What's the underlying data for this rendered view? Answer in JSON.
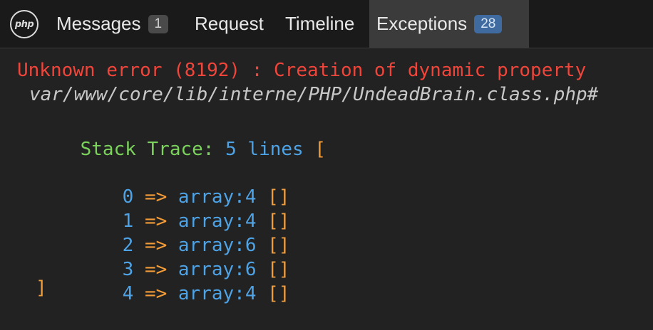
{
  "toolbar": {
    "logo_text": "php",
    "tabs": [
      {
        "label": "Messages",
        "badge": "1"
      },
      {
        "label": "Request"
      },
      {
        "label": "Timeline"
      },
      {
        "label": "Exceptions",
        "badge": "28",
        "active": true
      }
    ]
  },
  "exception": {
    "message": "Unknown error (8192) : Creation of dynamic property",
    "path": "var/www/core/lib/interne/PHP/UndeadBrain.class.php#",
    "trace_label": "Stack Trace:",
    "trace_count": "5 lines",
    "open_bracket": "[",
    "close_bracket": "]",
    "rows": [
      {
        "index": "0",
        "arrow": "=>",
        "value": "array:4",
        "bracket": "[]"
      },
      {
        "index": "1",
        "arrow": "=>",
        "value": "array:4",
        "bracket": "[]"
      },
      {
        "index": "2",
        "arrow": "=>",
        "value": "array:6",
        "bracket": "[]"
      },
      {
        "index": "3",
        "arrow": "=>",
        "value": "array:6",
        "bracket": "[]"
      },
      {
        "index": "4",
        "arrow": "=>",
        "value": "array:4",
        "bracket": "[]"
      }
    ]
  },
  "colors": {
    "error": "#f0453a",
    "label": "#7bd35c",
    "value": "#4da3e6",
    "bracket": "#f39c3a",
    "active_badge": "#3f6ba0"
  }
}
